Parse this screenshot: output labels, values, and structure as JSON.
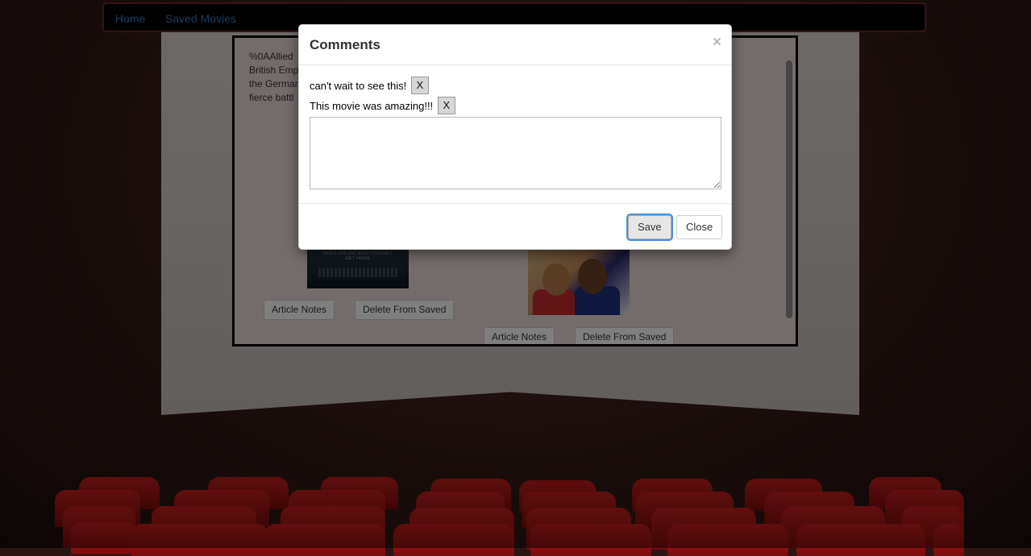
{
  "nav": {
    "home": "Home",
    "saved": "Saved Movies"
  },
  "article": {
    "text": "%0AAllied ... British Emp... the German... fierce battl..."
  },
  "cards": [
    {
      "notes_label": "Article Notes",
      "delete_label": "Delete From Saved"
    },
    {
      "notes_label": "Article Notes",
      "delete_label": "Delete From Saved"
    }
  ],
  "modal": {
    "title": "Comments",
    "close_glyph": "×",
    "comments": [
      {
        "text": "can't wait to see this!",
        "delete_label": "X"
      },
      {
        "text": "This movie was amazing!!!",
        "delete_label": "X"
      }
    ],
    "new_comment_value": "",
    "save_label": "Save",
    "close_label": "Close"
  }
}
